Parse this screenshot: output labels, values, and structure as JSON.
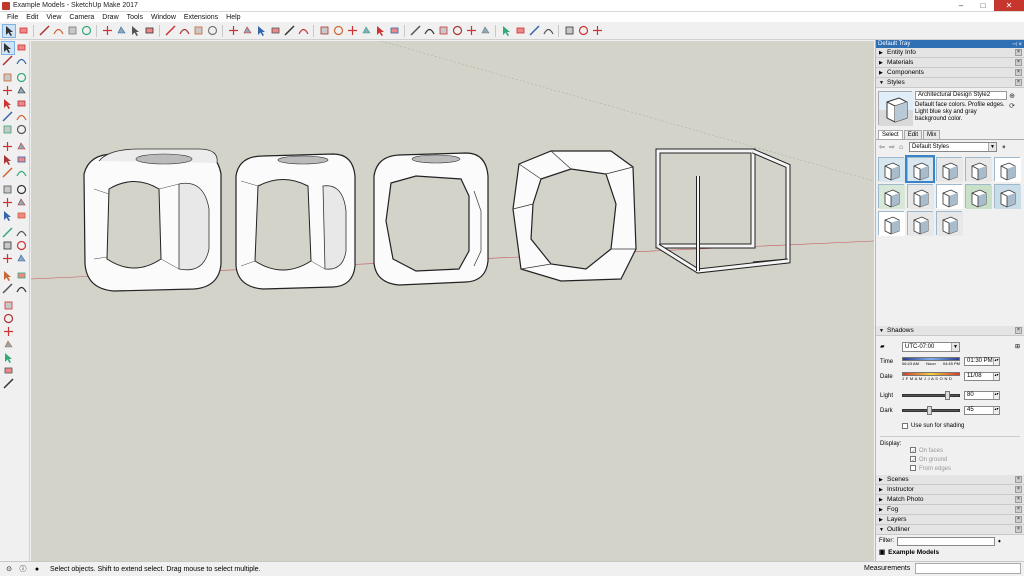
{
  "window": {
    "title": "Example Models - SketchUp Make 2017",
    "controls": [
      "–",
      "□",
      "✕"
    ]
  },
  "menu": [
    "File",
    "Edit",
    "View",
    "Camera",
    "Draw",
    "Tools",
    "Window",
    "Extensions",
    "Help"
  ],
  "tray": {
    "title": "Default Tray",
    "pin": "⊣ ×",
    "panels_top": [
      "Entity Info",
      "Materials",
      "Components"
    ],
    "styles": {
      "header": "Styles",
      "name": "Architectural Design Style2",
      "description": "Default face colors. Profile edges. Light blue sky and gray background color.",
      "tabs": [
        "Select",
        "Edit",
        "Mix"
      ],
      "collection": "Default Styles"
    },
    "shadows": {
      "header": "Shadows",
      "timezone": "UTC-07:00",
      "time_label": "Time",
      "time_scale": [
        "06:43 AM",
        "Noon",
        "04:45 PM"
      ],
      "time_value": "01:30 PM",
      "date_label": "Date",
      "date_scale": "J F M A M J J A S O N D",
      "date_value": "11/08",
      "light_label": "Light",
      "light_value": "80",
      "light_level": 0.8,
      "dark_label": "Dark",
      "dark_value": "45",
      "dark_level": 0.45,
      "use_sun": "Use sun for shading",
      "display_label": "Display:",
      "on_faces": "On faces",
      "on_ground": "On ground",
      "from_edges": "From edges"
    },
    "panels_bottom": [
      "Scenes",
      "Instructor",
      "Match Photo",
      "Fog",
      "Layers"
    ],
    "outliner": {
      "header": "Outliner",
      "filter_label": "Filter:",
      "root": "Example Models"
    }
  },
  "status": {
    "message": "Select objects. Shift to extend select. Drag mouse to select multiple.",
    "measurements_label": "Measurements"
  },
  "icons": {
    "toolbar": [
      "select-icon",
      "eraser-icon",
      "line-icon",
      "arc-icon",
      "shape-icon",
      "pushpull-icon",
      "move-icon",
      "rotate-icon",
      "scale-icon",
      "offset-icon",
      "tape-icon",
      "paint-icon",
      "text-icon",
      "axes-icon",
      "orbit-icon",
      "pan-icon",
      "zoom-icon",
      "zoom-extents-icon",
      "warehouse-icon",
      "components-icon",
      "iso-icon",
      "top-icon",
      "front-icon",
      "right-icon",
      "back-icon",
      "left-icon",
      "xray-icon",
      "wireframe-icon",
      "hidden-icon",
      "shaded-icon",
      "textured-icon",
      "monochrome-icon",
      "section-icon",
      "sandbox-icon",
      "solid-icon",
      "eye-icon",
      "walk-icon",
      "position-camera-icon",
      "look-around-icon"
    ]
  },
  "colors": {
    "viewport_bg": "#d3d3ca",
    "tray_header": "#2f6fb3",
    "close_button": "#c7362d"
  }
}
